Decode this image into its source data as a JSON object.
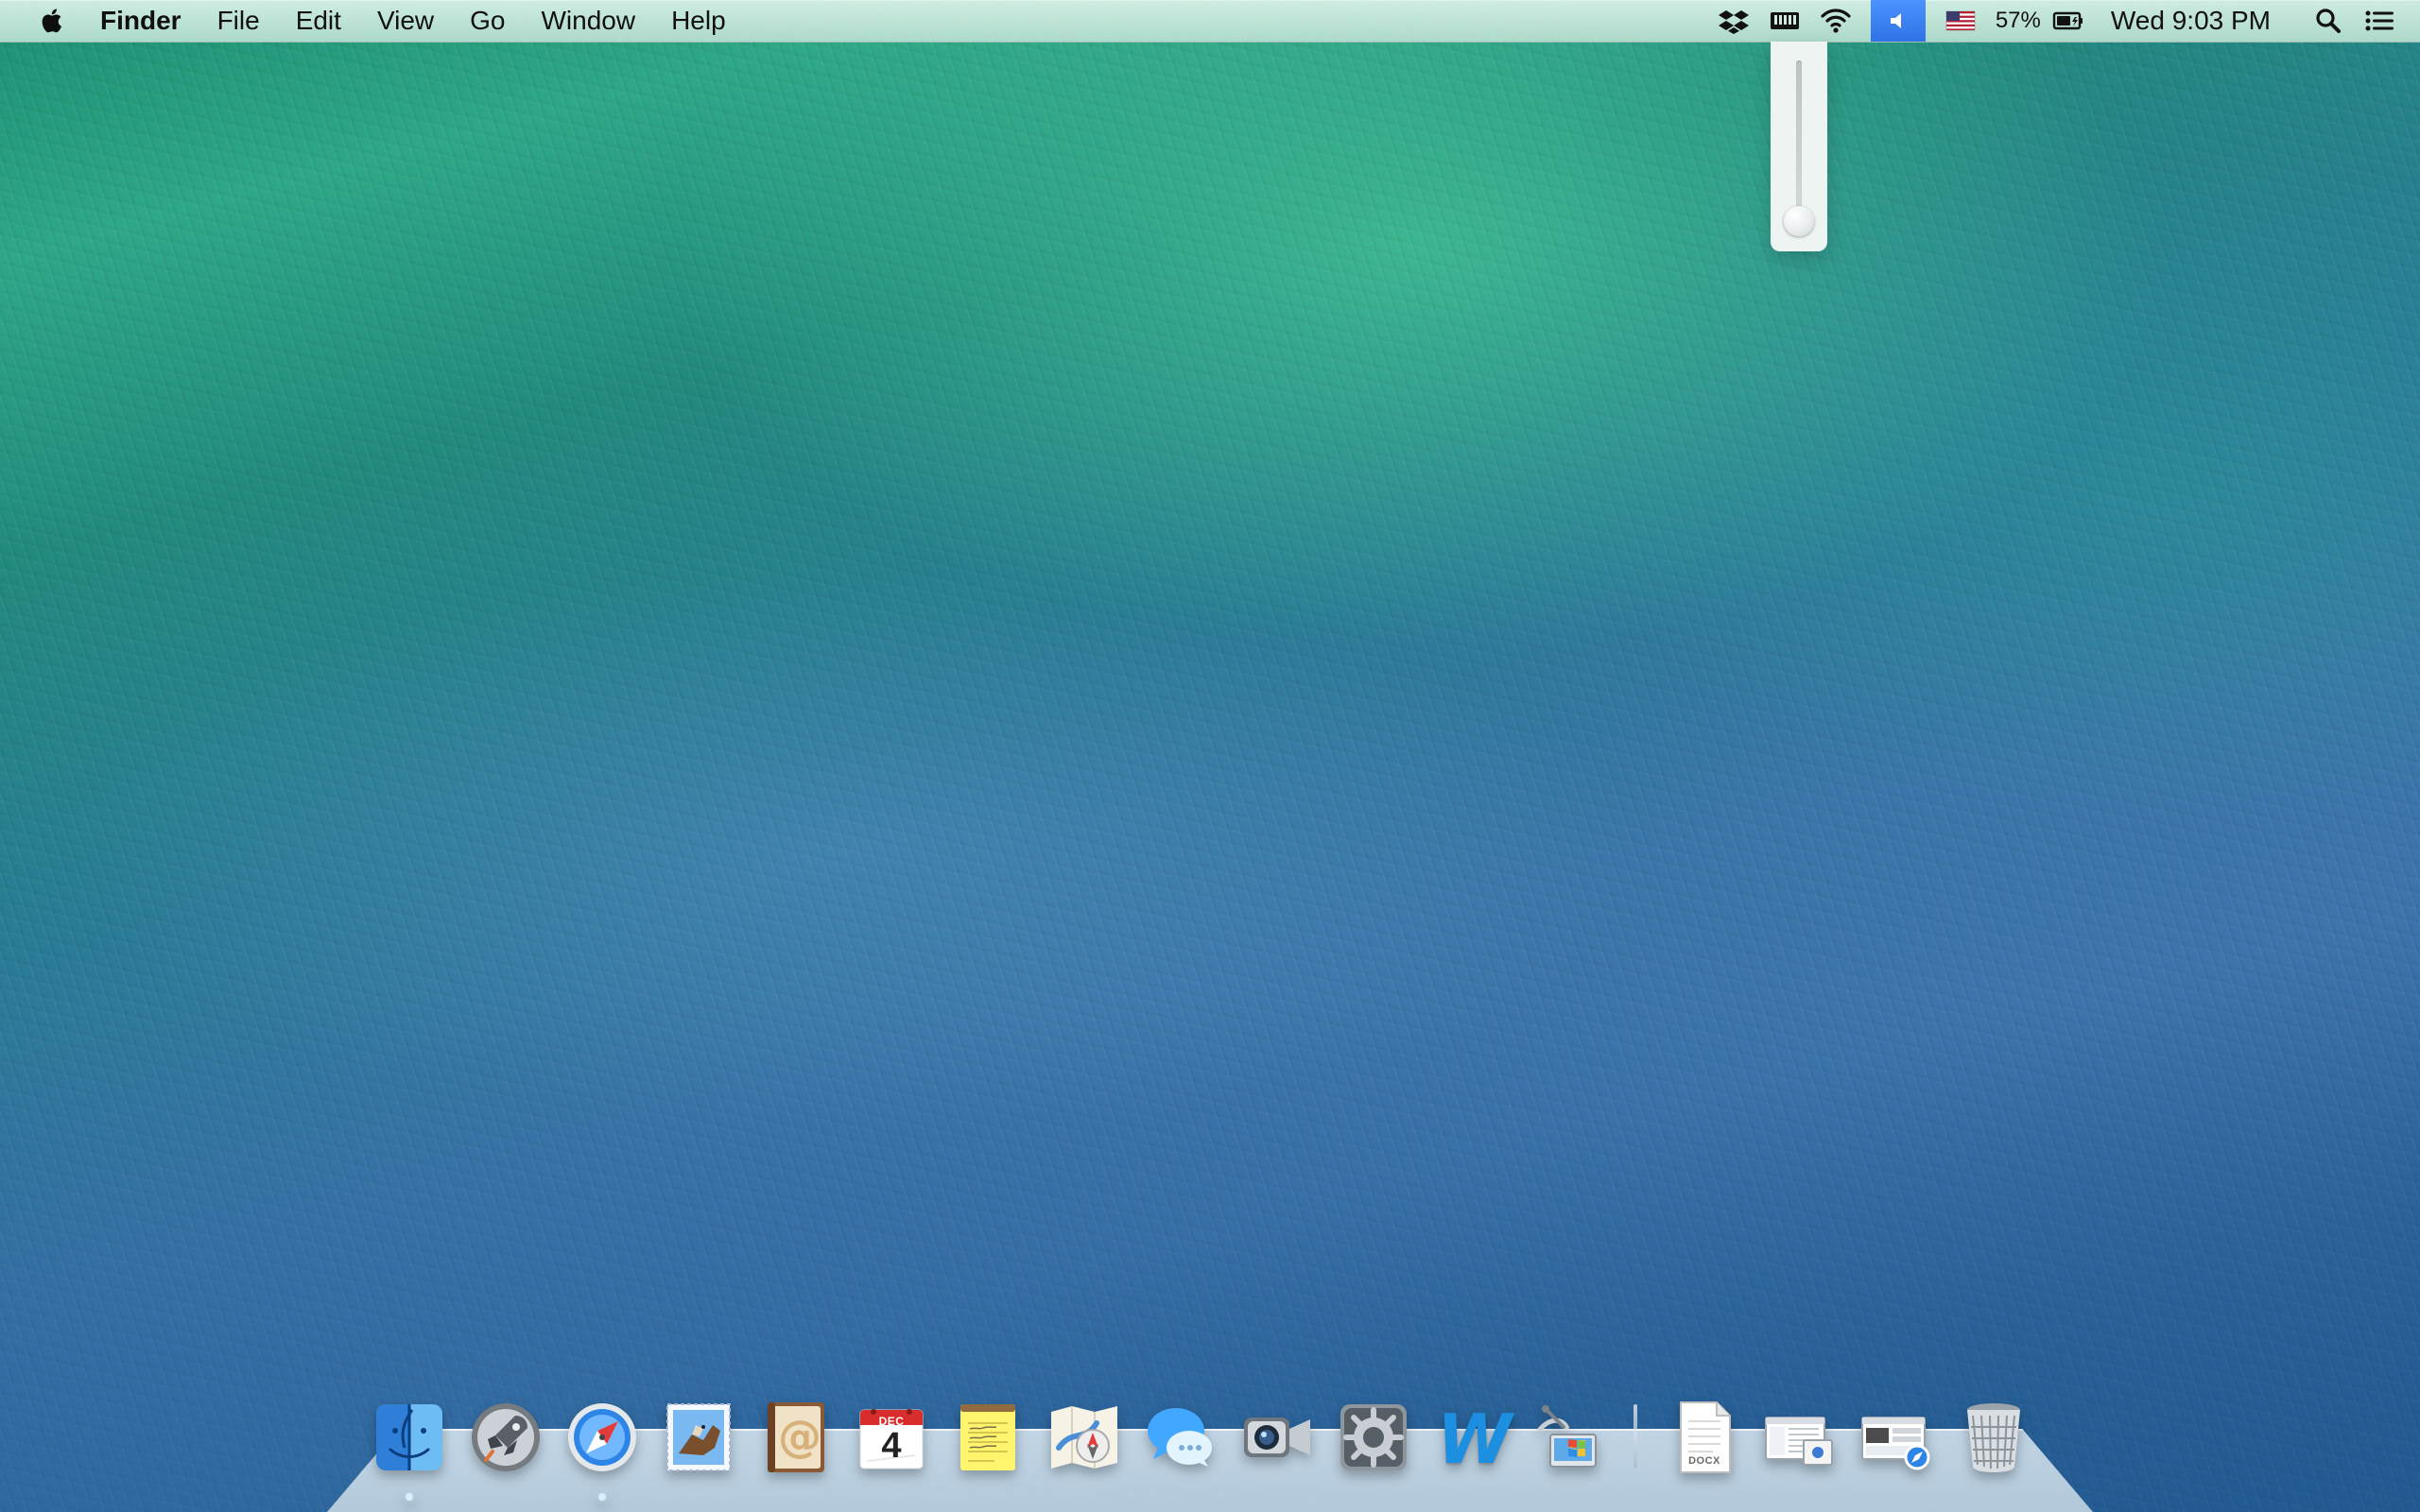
{
  "menubar": {
    "app_name": "Finder",
    "items": [
      "File",
      "Edit",
      "View",
      "Go",
      "Window",
      "Help"
    ],
    "battery_percent": "57%",
    "clock": "Wed 9:03 PM"
  },
  "volume": {
    "level": 0.0
  },
  "dock": {
    "items": [
      {
        "name": "Finder",
        "icon": "finder-icon"
      },
      {
        "name": "Launchpad",
        "icon": "rocket-icon"
      },
      {
        "name": "Safari",
        "icon": "compass-icon"
      },
      {
        "name": "Mail",
        "icon": "stamp-icon"
      },
      {
        "name": "Contacts",
        "icon": "address-book-icon",
        "symbol": "@"
      },
      {
        "name": "Calendar",
        "icon": "calendar-icon",
        "month": "DEC",
        "day": "4"
      },
      {
        "name": "Notes",
        "icon": "notes-icon"
      },
      {
        "name": "Maps",
        "icon": "map-icon"
      },
      {
        "name": "Messages",
        "icon": "chat-bubble-icon"
      },
      {
        "name": "FaceTime",
        "icon": "camera-icon"
      },
      {
        "name": "System Preferences",
        "icon": "gear-icon"
      },
      {
        "name": "Word",
        "icon": "word-icon",
        "letter": "W"
      },
      {
        "name": "Remote Desktop",
        "icon": "satellite-icon"
      },
      {
        "name": "Document",
        "icon": "document-icon",
        "label": "DOCX"
      },
      {
        "name": "Downloads",
        "icon": "window-stack-icon"
      },
      {
        "name": "Safari Window",
        "icon": "browser-window-icon"
      },
      {
        "name": "Trash",
        "icon": "trash-icon"
      }
    ]
  },
  "colors": {
    "menubar_tint": "#cfe9de",
    "selection_blue": "#2f72e6",
    "wallpaper_green": "#2ea887",
    "wallpaper_blue": "#2d649a"
  }
}
